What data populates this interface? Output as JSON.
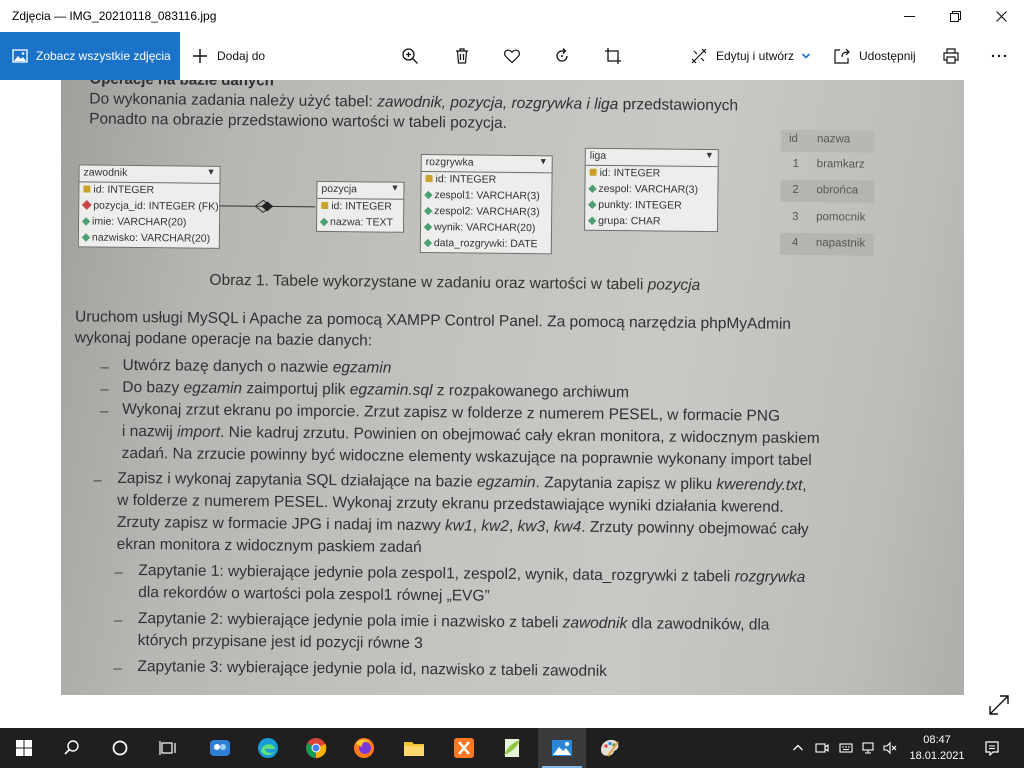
{
  "window": {
    "title": "Zdjęcia — IMG_20210118_083116.jpg"
  },
  "toolbar": {
    "view_all_label": "Zobacz wszystkie zdjęcia",
    "add_to_label": "Dodaj do",
    "edit_create_label": "Edytuj i utwórz",
    "share_label": "Udostępnij",
    "icons": [
      "zoom-icon",
      "delete-icon",
      "favorite-icon",
      "rotate-icon",
      "crop-icon",
      "print-icon",
      "more-icon"
    ]
  },
  "photo": {
    "heading": "Operacje na bazie danych",
    "intro_1_a": "Do wykonania zadania należy użyć tabel: ",
    "intro_1_b": "zawodnik, pozycja, rozgrywka i liga",
    "intro_1_c": " przedstawionych",
    "intro_2": "Ponadto na obrazie przedstawiono wartości w tabeli pozycja.",
    "tables": {
      "zawodnik": {
        "name": "zawodnik",
        "rows": [
          "id: INTEGER",
          "pozycja_id: INTEGER (FK)",
          "imie: VARCHAR(20)",
          "nazwisko: VARCHAR(20)"
        ]
      },
      "pozycja": {
        "name": "pozycja",
        "rows": [
          "id: INTEGER",
          "nazwa: TEXT"
        ]
      },
      "rozgrywka": {
        "name": "rozgrywka",
        "rows": [
          "id: INTEGER",
          "zespol1: VARCHAR(3)",
          "zespol2: VARCHAR(3)",
          "wynik: VARCHAR(20)",
          "data_rozgrywki: DATE"
        ]
      },
      "liga": {
        "name": "liga",
        "rows": [
          "id: INTEGER",
          "zespol: VARCHAR(3)",
          "punkty: INTEGER",
          "grupa: CHAR"
        ]
      }
    },
    "pozycja_values": {
      "headers": [
        "id",
        "nazwa"
      ],
      "rows": [
        [
          "1",
          "bramkarz"
        ],
        [
          "2",
          "obrońca"
        ],
        [
          "3",
          "pomocnik"
        ],
        [
          "4",
          "napastnik"
        ]
      ]
    },
    "caption_a": "Obraz 1. Tabele wykorzystane w zadaniu oraz wartości w tabeli ",
    "caption_b": "pozycja",
    "p1": "Uruchom usługi MySQL i Apache za pomocą XAMPP Control Panel. Za pomocą narzędzia phpMyAdmin",
    "p2": "wykonaj podane operacje na bazie danych:",
    "b1_a": "Utwórz bazę danych o nazwie ",
    "b1_b": "egzamin",
    "b2_a": "Do bazy ",
    "b2_b": "egzamin",
    "b2_c": " zaimportuj plik ",
    "b2_d": "egzamin.sql",
    "b2_e": " z rozpakowanego archiwum",
    "b3_l1": "Wykonaj zrzut ekranu po imporcie. Zrzut zapisz w folderze z numerem PESEL, w formacie PNG",
    "b3_l2_a": "i nazwij ",
    "b3_l2_b": "import",
    "b3_l2_c": ". Nie kadruj zrzutu. Powinien on obejmować cały ekran monitora, z widocznym paskiem",
    "b3_l3": "zadań. Na zrzucie powinny być widoczne elementy wskazujące na poprawnie wykonany import tabel",
    "b4_l1_a": "Zapisz i wykonaj zapytania SQL działające na bazie ",
    "b4_l1_b": "egzamin",
    "b4_l1_c": ". Zapytania zapisz w pliku ",
    "b4_l1_d": "kwerendy.txt",
    "b4_l1_e": ",",
    "b4_l2": "w folderze z numerem PESEL. Wykonaj zrzuty ekranu przedstawiające wyniki działania kwerend.",
    "b4_l3_a": "Zrzuty zapisz w formacie JPG i nadaj im nazwy ",
    "b4_l3_b": "kw1",
    "b4_l3_c": ", ",
    "b4_l3_d": "kw2",
    "b4_l3_e": ", ",
    "b4_l3_f": "kw3",
    "b4_l3_g": ", ",
    "b4_l3_h": "kw4",
    "b4_l3_i": ". Zrzuty powinny obejmować cały",
    "b4_l4": "ekran monitora z widocznym paskiem zadań",
    "s1_l1": "Zapytanie 1: wybierające jedynie pola zespol1, zespol2, wynik, data_rozgrywki z tabeli ",
    "s1_l1_b": "rozgrywka",
    "s1_l2": "dla rekordów o wartości pola zespol1 równej „EVG”",
    "s2_l1_a": "Zapytanie 2: wybierające jedynie pola imie i nazwisko z tabeli ",
    "s2_l1_b": "zawodnik",
    "s2_l1_c": " dla zawodników, dla",
    "s2_l2": "których przypisane jest id pozycji równe 3",
    "s3_l1": "Zapytanie 3: wybierające jedynie pola id, nazwisko z tabeli zawodnik"
  },
  "taskbar": {
    "apps": [
      "windows-start-icon",
      "search-icon",
      "cortana-icon",
      "task-view-icon",
      "people-app-icon",
      "edge-icon",
      "chrome-icon",
      "firefox-icon",
      "file-explorer-icon",
      "xampp-icon",
      "notepad-plus-icon",
      "photos-icon",
      "paint-3d-icon"
    ],
    "time": "08:47",
    "date": "18.01.2021"
  },
  "colors": {
    "accent": "#1a73c8",
    "taskbar": "#1f1f1f"
  }
}
